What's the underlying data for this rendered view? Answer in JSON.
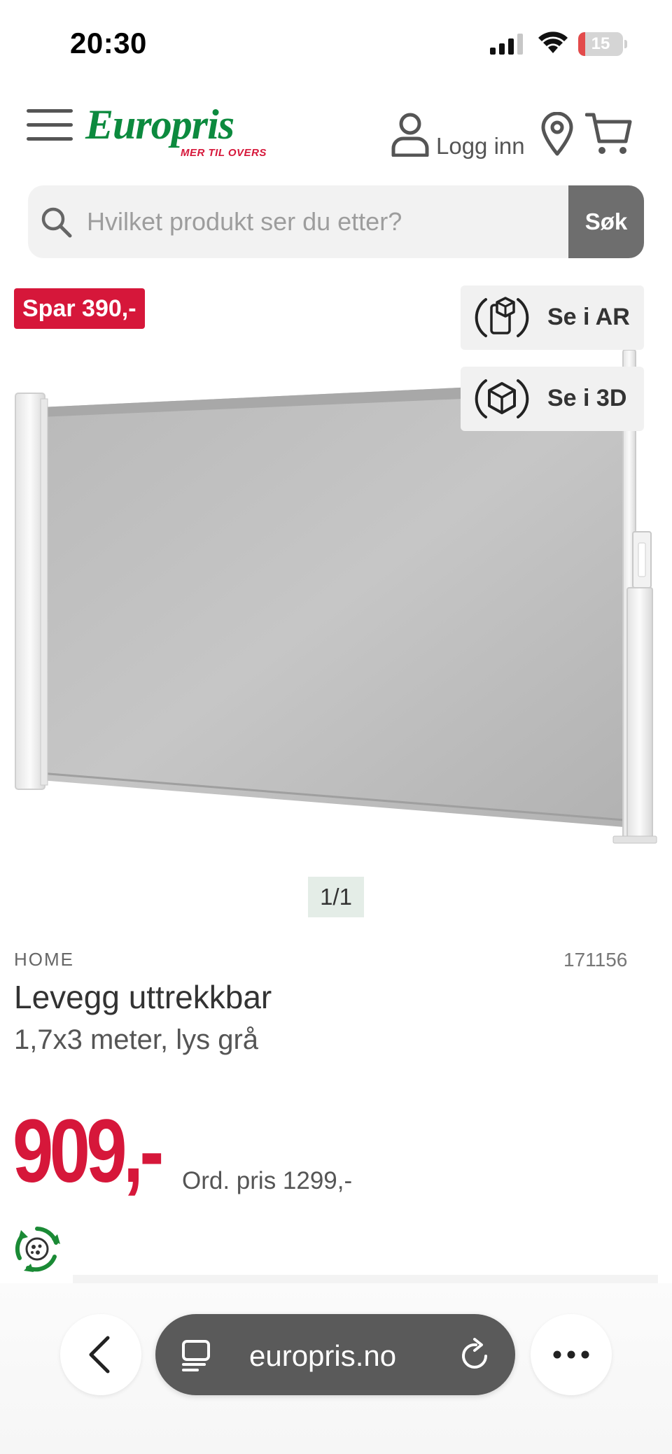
{
  "status_bar": {
    "time": "20:30",
    "battery_level": "15",
    "battery_fraction": 0.15
  },
  "header": {
    "logo_text": "Europris",
    "logo_tagline": "MER TIL OVERS",
    "login_label": "Logg inn",
    "icons": [
      "menu-icon",
      "user-icon",
      "map-pin-icon",
      "cart-icon"
    ]
  },
  "search": {
    "placeholder": "Hvilket produkt ser du etter?",
    "button_label": "Søk"
  },
  "media": {
    "save_badge": "Spar 390,-",
    "view_ar_label": "Se i AR",
    "view_3d_label": "Se i 3D",
    "pager": "1/1"
  },
  "product": {
    "brand": "HOME",
    "sku": "171156",
    "title": "Levegg uttrekkbar",
    "subtitle": "1,7x3 meter, lys grå",
    "price": "909,-",
    "ordinary_price": "Ord. pris 1299,-"
  },
  "browser": {
    "url": "europris.no"
  },
  "colors": {
    "brand_green": "#0c8a3e",
    "sale_red": "#d6173a",
    "search_button": "#6e6e6e",
    "url_bar": "#5a5a5a"
  }
}
